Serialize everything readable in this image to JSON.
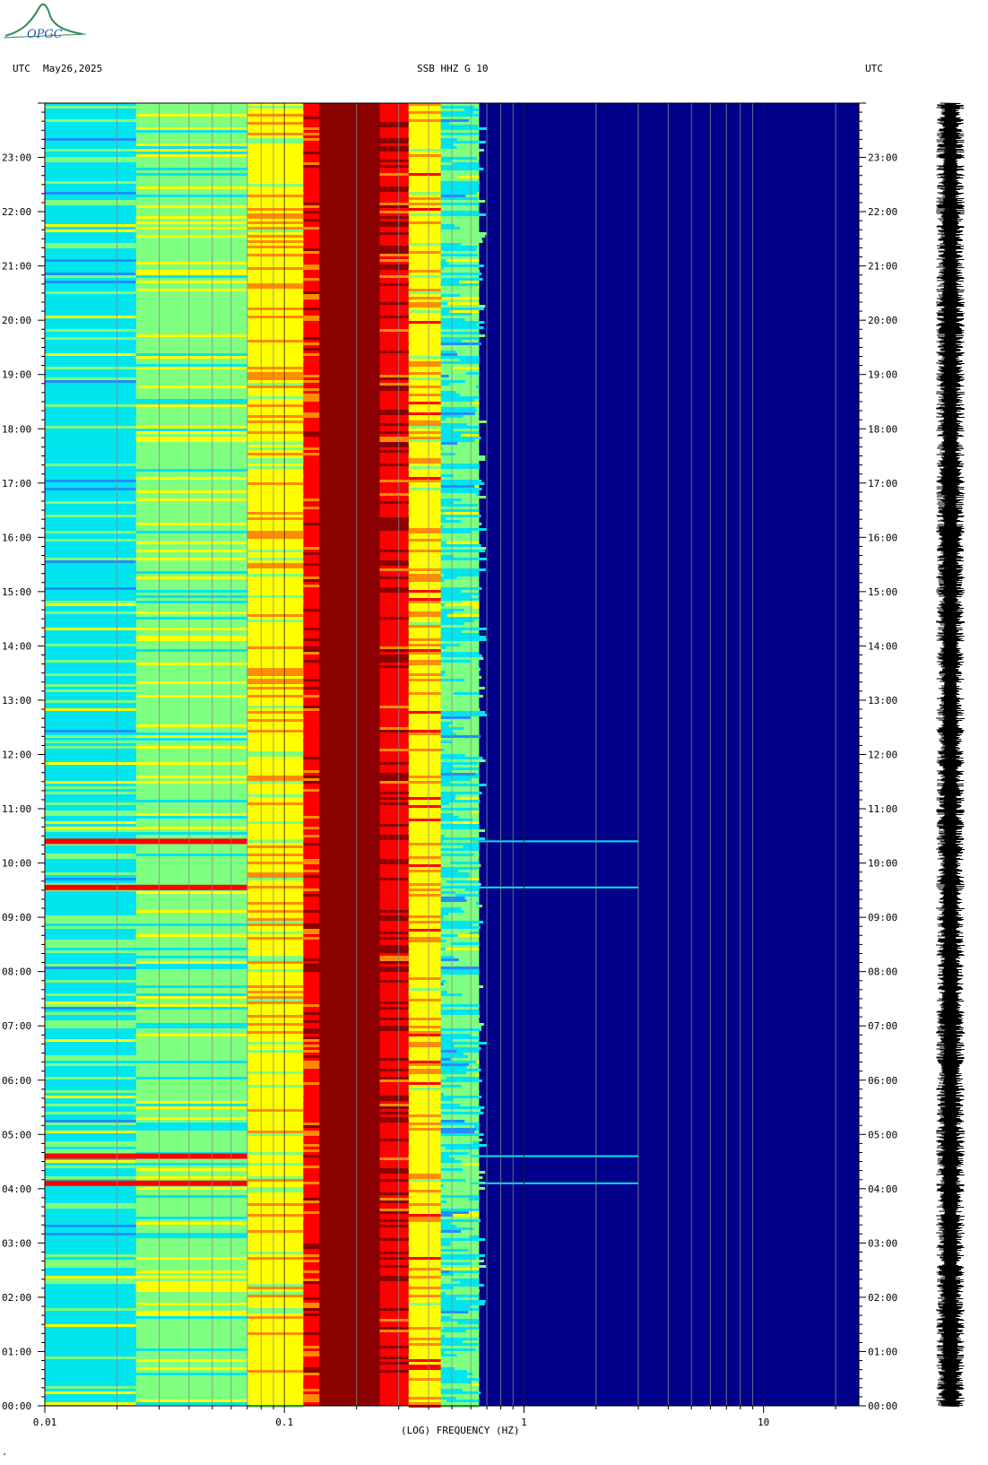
{
  "header": {
    "left_utc": "UTC",
    "date": "May26,2025",
    "station": "SSB HHZ G 10",
    "right_utc": "UTC"
  },
  "logo": {
    "text": "OPGC",
    "color": "#2e8b57"
  },
  "footer": {
    "mark": "\""
  },
  "chart_data": {
    "type": "heatmap",
    "title": "SSB HHZ G 10",
    "xlabel": "(LOG) FREQUENCY (HZ)",
    "ylabel": "",
    "xscale": "log",
    "xlim": [
      0.01,
      25
    ],
    "ylim_hours": [
      0,
      24
    ],
    "x_ticks": [
      {
        "value": 0.01,
        "label": "0.01"
      },
      {
        "value": 0.1,
        "label": "0.1"
      },
      {
        "value": 1,
        "label": "1"
      },
      {
        "value": 10,
        "label": "10"
      }
    ],
    "y_ticks": [
      "00:00",
      "01:00",
      "02:00",
      "03:00",
      "04:00",
      "05:00",
      "06:00",
      "07:00",
      "08:00",
      "09:00",
      "10:00",
      "11:00",
      "12:00",
      "13:00",
      "14:00",
      "15:00",
      "16:00",
      "17:00",
      "18:00",
      "19:00",
      "20:00",
      "21:00",
      "22:00",
      "23:00"
    ],
    "colormap": [
      "#00008b",
      "#1e90ff",
      "#00e5ee",
      "#7fff7f",
      "#ffff00",
      "#ff8c00",
      "#ff0000",
      "#8b0000"
    ],
    "frequency_bands": [
      {
        "from": 0.01,
        "to": 0.024,
        "level": 0.35
      },
      {
        "from": 0.024,
        "to": 0.07,
        "level": 0.42
      },
      {
        "from": 0.07,
        "to": 0.12,
        "level": 0.58
      },
      {
        "from": 0.12,
        "to": 0.14,
        "level": 0.82
      },
      {
        "from": 0.14,
        "to": 0.25,
        "level": 1.0
      },
      {
        "from": 0.25,
        "to": 0.33,
        "level": 0.9
      },
      {
        "from": 0.33,
        "to": 0.45,
        "level": 0.62
      },
      {
        "from": 0.45,
        "to": 0.65,
        "level": 0.38
      },
      {
        "from": 0.65,
        "to": 25,
        "level": 0.05
      }
    ],
    "events_hours": [
      4.1,
      4.6,
      9.55,
      10.4
    ]
  }
}
